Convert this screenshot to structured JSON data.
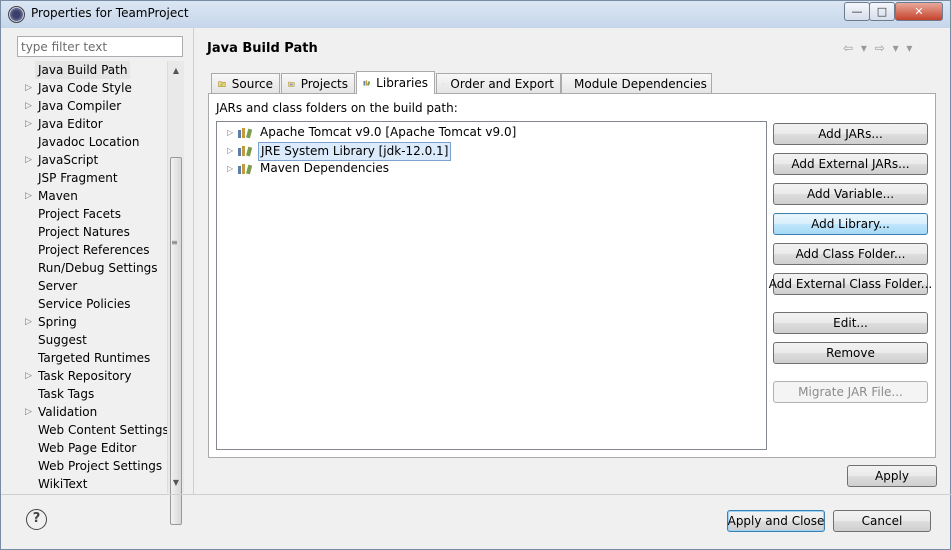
{
  "window": {
    "title": "Properties for TeamProject",
    "controls": {
      "minimize": "—",
      "maximize": "□",
      "close": "✕"
    }
  },
  "filter": {
    "placeholder": "type filter text"
  },
  "tree": {
    "items": [
      {
        "label": "Java Build Path",
        "expandable": false,
        "selected": true
      },
      {
        "label": "Java Code Style",
        "expandable": true
      },
      {
        "label": "Java Compiler",
        "expandable": true
      },
      {
        "label": "Java Editor",
        "expandable": true
      },
      {
        "label": "Javadoc Location",
        "expandable": false
      },
      {
        "label": "JavaScript",
        "expandable": true
      },
      {
        "label": "JSP Fragment",
        "expandable": false
      },
      {
        "label": "Maven",
        "expandable": true
      },
      {
        "label": "Project Facets",
        "expandable": false
      },
      {
        "label": "Project Natures",
        "expandable": false
      },
      {
        "label": "Project References",
        "expandable": false
      },
      {
        "label": "Run/Debug Settings",
        "expandable": false
      },
      {
        "label": "Server",
        "expandable": false
      },
      {
        "label": "Service Policies",
        "expandable": false
      },
      {
        "label": "Spring",
        "expandable": true
      },
      {
        "label": "Suggest",
        "expandable": false
      },
      {
        "label": "Targeted Runtimes",
        "expandable": false
      },
      {
        "label": "Task Repository",
        "expandable": true
      },
      {
        "label": "Task Tags",
        "expandable": false
      },
      {
        "label": "Validation",
        "expandable": true
      },
      {
        "label": "Web Content Settings",
        "expandable": false
      },
      {
        "label": "Web Page Editor",
        "expandable": false
      },
      {
        "label": "Web Project Settings",
        "expandable": false
      },
      {
        "label": "WikiText",
        "expandable": false
      }
    ]
  },
  "page": {
    "title": "Java Build Path",
    "nav_arrows": "⇦ ▾ ⇨ ▾ ▾"
  },
  "tabs": [
    {
      "label": "Source",
      "icon": "source-folder-icon"
    },
    {
      "label": "Projects",
      "icon": "projects-icon"
    },
    {
      "label": "Libraries",
      "icon": "libraries-icon",
      "active": true
    },
    {
      "label": "Order and Export",
      "icon": "order-export-icon"
    },
    {
      "label": "Module Dependencies",
      "icon": "module-icon"
    }
  ],
  "libraries": {
    "caption": "JARs and class folders on the build path:",
    "items": [
      {
        "label": "Apache Tomcat v9.0 [Apache Tomcat v9.0]"
      },
      {
        "label": "JRE System Library [jdk-12.0.1]",
        "selected": true
      },
      {
        "label": "Maven Dependencies"
      }
    ]
  },
  "buttons": {
    "add_jars": "Add JARs...",
    "add_external_jars": "Add External JARs...",
    "add_variable": "Add Variable...",
    "add_library": "Add Library...",
    "add_class_folder": "Add Class Folder...",
    "add_external_class_folder": "Add External Class Folder...",
    "edit": "Edit...",
    "remove": "Remove",
    "migrate_jar": "Migrate JAR File...",
    "apply": "Apply",
    "apply_and_close": "Apply and Close",
    "cancel": "Cancel"
  },
  "help": {
    "glyph": "?"
  },
  "colors": {
    "accent_border": "#3c7fb1",
    "selection_bg": "#dcebfc"
  }
}
